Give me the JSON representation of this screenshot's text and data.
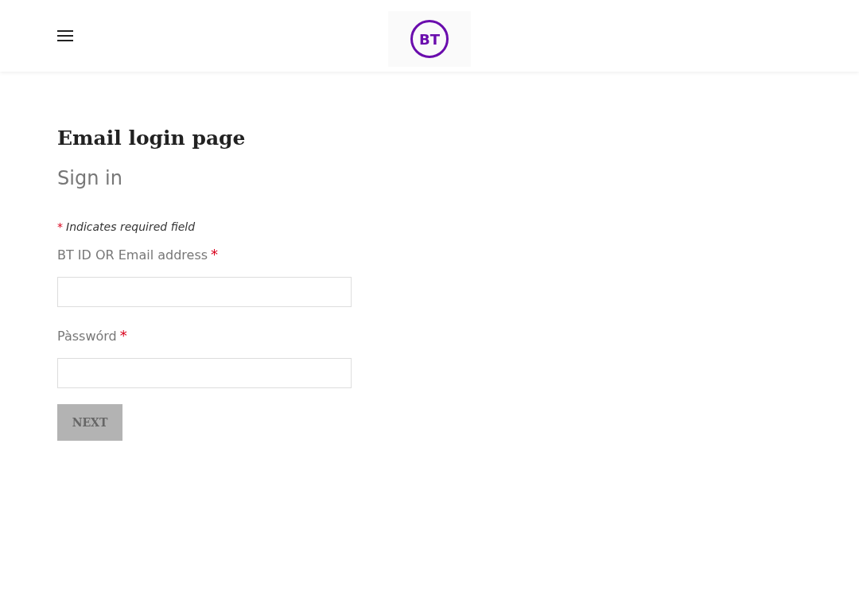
{
  "header": {
    "logo_text": "BT"
  },
  "page_title": "Email login page",
  "form": {
    "title": "Sign in",
    "required_note": {
      "mark": "*",
      "text": "Indicates required field"
    },
    "fields": [
      {
        "label": "BT ID OR Email address",
        "required_mark": "*"
      },
      {
        "label": "Pàsswórd",
        "required_mark": "*"
      }
    ],
    "submit": {
      "label": "NEXT",
      "disabled": true
    }
  }
}
